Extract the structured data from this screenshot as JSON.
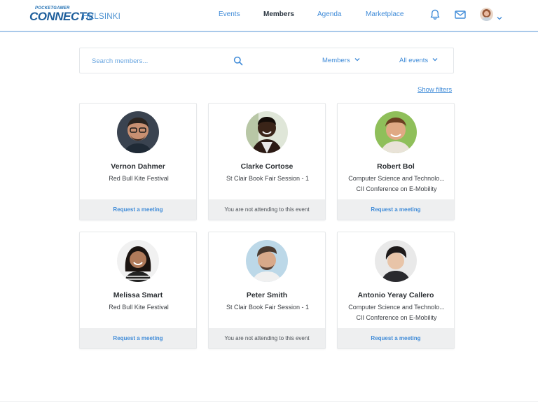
{
  "header": {
    "logo": {
      "top_text": "POCKETGAMER",
      "main_text": "CONNECTS",
      "city": "HELSINKI"
    },
    "nav": [
      {
        "label": "Events",
        "active": false
      },
      {
        "label": "Members",
        "active": true
      },
      {
        "label": "Agenda",
        "active": false
      },
      {
        "label": "Marketplace",
        "active": false
      }
    ],
    "icons": [
      "bell-icon",
      "mail-icon",
      "avatar",
      "chevron-down-icon"
    ]
  },
  "search": {
    "placeholder": "Search members...",
    "value": "",
    "type_filter": "Members",
    "event_filter": "All events"
  },
  "show_filters_label": "Show filters",
  "members": [
    {
      "name": "Vernon Dahmer",
      "line1": "Red Bull Kite Festival",
      "line2": "",
      "action": "Request a meeting",
      "action_type": "link"
    },
    {
      "name": "Clarke Cortose",
      "line1": "St Clair Book Fair Session - 1",
      "line2": "",
      "action": "You are not attending to this event",
      "action_type": "muted"
    },
    {
      "name": "Robert Bol",
      "line1": "Computer Science and Technolo...",
      "line2": "CII Conference on E-Mobility",
      "action": "Request a meeting",
      "action_type": "link"
    },
    {
      "name": "Melissa Smart",
      "line1": "Red Bull Kite Festival",
      "line2": "",
      "action": "Request a meeting",
      "action_type": "link"
    },
    {
      "name": "Peter Smith",
      "line1": "St Clair Book Fair Session - 1",
      "line2": "",
      "action": "You are not attending to this event",
      "action_type": "muted"
    },
    {
      "name": "Antonio Yeray Callero",
      "line1": "Computer Science and Technolo...",
      "line2": "CII Conference on E-Mobility",
      "action": "Request a meeting",
      "action_type": "link"
    }
  ],
  "colors": {
    "accent": "#3f8bd8",
    "header_border": "#a9c9ea",
    "footer_bg": "#eeeff0",
    "active_nav": "#2a3540"
  }
}
